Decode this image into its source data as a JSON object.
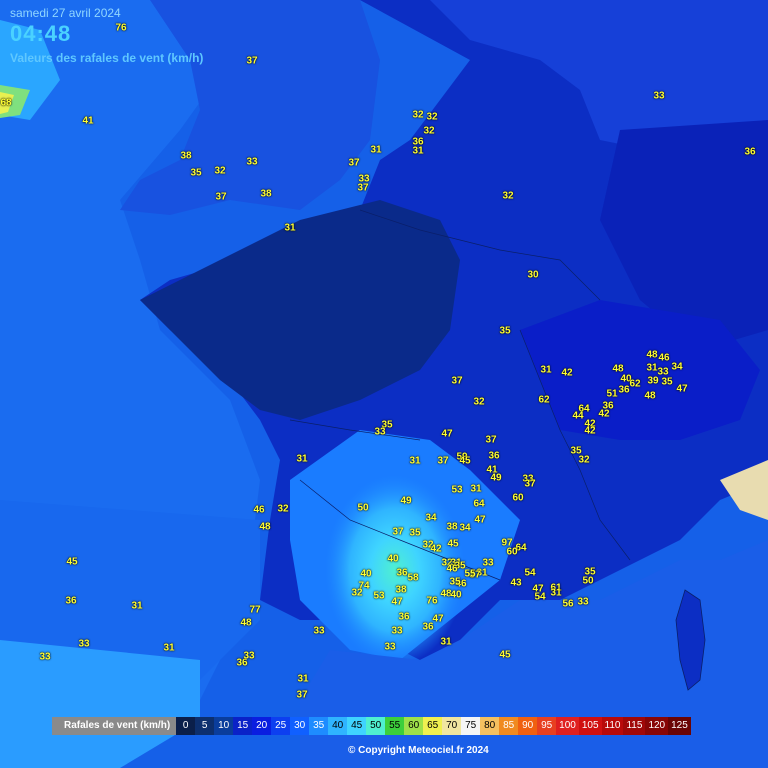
{
  "header": {
    "date": "samedi 27 avril 2024",
    "time": "04:48",
    "subtitle": "Valeurs des rafales de vent (km/h)"
  },
  "legend": {
    "title": "Rafales de vent (km/h)",
    "items": [
      {
        "value": "0",
        "color": "#0b1f4a",
        "text": "#ffffff"
      },
      {
        "value": "5",
        "color": "#0d2f6e",
        "text": "#ffffff"
      },
      {
        "value": "10",
        "color": "#0a3d9c",
        "text": "#ffffff"
      },
      {
        "value": "15",
        "color": "#0a22c8",
        "text": "#ffffff"
      },
      {
        "value": "20",
        "color": "#0a1ee0",
        "text": "#ffffff"
      },
      {
        "value": "25",
        "color": "#0d3ff0",
        "text": "#ffffff"
      },
      {
        "value": "30",
        "color": "#1060ff",
        "text": "#ffffff"
      },
      {
        "value": "35",
        "color": "#1e8cff",
        "text": "#ffffff"
      },
      {
        "value": "40",
        "color": "#2fb4ff",
        "text": "#000000"
      },
      {
        "value": "45",
        "color": "#3fd4ff",
        "text": "#000000"
      },
      {
        "value": "50",
        "color": "#4ff0d0",
        "text": "#000000"
      },
      {
        "value": "55",
        "color": "#3ccf3c",
        "text": "#000000"
      },
      {
        "value": "60",
        "color": "#9ee04a",
        "text": "#000000"
      },
      {
        "value": "65",
        "color": "#f0f050",
        "text": "#000000"
      },
      {
        "value": "70",
        "color": "#f0e6a0",
        "text": "#000000"
      },
      {
        "value": "75",
        "color": "#f5f5f5",
        "text": "#000000"
      },
      {
        "value": "80",
        "color": "#f5c060",
        "text": "#000000"
      },
      {
        "value": "85",
        "color": "#f08a20",
        "text": "#ffffff"
      },
      {
        "value": "90",
        "color": "#f06010",
        "text": "#ffffff"
      },
      {
        "value": "95",
        "color": "#e84020",
        "text": "#ffffff"
      },
      {
        "value": "100",
        "color": "#e02020",
        "text": "#ffffff"
      },
      {
        "value": "105",
        "color": "#d01010",
        "text": "#ffffff"
      },
      {
        "value": "110",
        "color": "#b80a0a",
        "text": "#ffffff"
      },
      {
        "value": "115",
        "color": "#a00808",
        "text": "#ffffff"
      },
      {
        "value": "120",
        "color": "#880606",
        "text": "#ffffff"
      },
      {
        "value": "125",
        "color": "#6a0404",
        "text": "#ffffff"
      }
    ]
  },
  "station_values": [
    "76",
    "37",
    "68",
    "41",
    "38",
    "35",
    "32",
    "33",
    "37",
    "38",
    "31",
    "32",
    "32",
    "32",
    "36",
    "31",
    "37",
    "31",
    "33",
    "37",
    "33",
    "36",
    "32",
    "30",
    "35",
    "37",
    "32",
    "31",
    "42",
    "62",
    "48",
    "48",
    "46",
    "31",
    "33",
    "34",
    "40",
    "62",
    "39",
    "35",
    "51",
    "36",
    "48",
    "47",
    "64",
    "44",
    "42",
    "36",
    "42",
    "42",
    "35",
    "32",
    "35",
    "33",
    "47",
    "37",
    "36",
    "31",
    "37",
    "59",
    "45",
    "41",
    "49",
    "53",
    "31",
    "33",
    "37",
    "60",
    "49",
    "50",
    "34",
    "38",
    "34",
    "47",
    "64",
    "37",
    "35",
    "32",
    "97",
    "64",
    "45",
    "42",
    "40",
    "32",
    "31",
    "35",
    "33",
    "60",
    "31",
    "37",
    "40",
    "36",
    "58",
    "46",
    "46",
    "54",
    "43",
    "47",
    "61",
    "54",
    "50",
    "31",
    "56",
    "33",
    "35",
    "47",
    "35",
    "55",
    "74",
    "32",
    "53",
    "47",
    "38",
    "76",
    "48",
    "40",
    "36",
    "33",
    "36",
    "31",
    "33",
    "45",
    "31",
    "31",
    "37",
    "46",
    "48",
    "32",
    "45",
    "36",
    "31",
    "48",
    "77",
    "33",
    "33",
    "33",
    "31",
    "36",
    "33"
  ],
  "copyright": "© Copyright Meteociel.fr 2024"
}
